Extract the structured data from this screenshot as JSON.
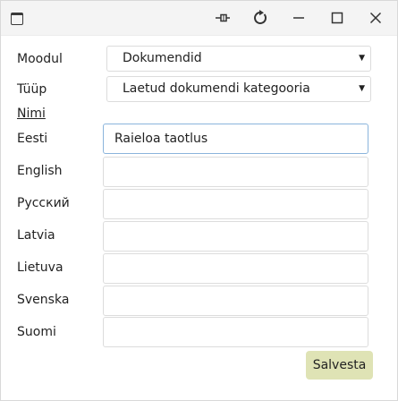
{
  "titlebar": {
    "icons": [
      "app-window-icon",
      "pin-icon",
      "refresh-icon",
      "minimize-icon",
      "maximize-icon",
      "close-icon"
    ]
  },
  "form": {
    "moodul_label": "Moodul",
    "moodul_value": "Dokumendid",
    "tyyp_label": "Tüüp",
    "tyyp_value": "Laetud dokumendi kategooria",
    "nimi_label": "Nimi",
    "names": [
      {
        "lang": "Eesti",
        "value": "Raieloa taotlus"
      },
      {
        "lang": "English",
        "value": ""
      },
      {
        "lang": "Русский",
        "value": ""
      },
      {
        "lang": "Latvia",
        "value": ""
      },
      {
        "lang": "Lietuva",
        "value": ""
      },
      {
        "lang": "Svenska",
        "value": ""
      },
      {
        "lang": "Suomi",
        "value": ""
      }
    ],
    "caret_glyph": "▼",
    "save_label": "Salvesta"
  },
  "colors": {
    "save_button_bg": "#dfe3b5",
    "focus_border": "#8ab4dc",
    "titlebar_bg": "#f4f4f4"
  }
}
